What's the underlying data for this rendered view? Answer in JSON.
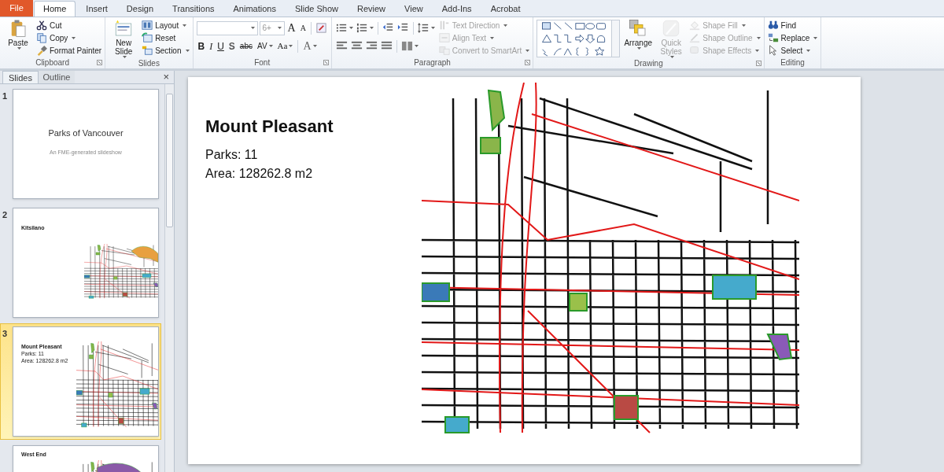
{
  "menu_tabs": [
    {
      "label": "File",
      "kind": "file",
      "selected": false
    },
    {
      "label": "Home",
      "kind": "tab",
      "selected": true
    },
    {
      "label": "Insert",
      "kind": "tab",
      "selected": false
    },
    {
      "label": "Design",
      "kind": "tab",
      "selected": false
    },
    {
      "label": "Transitions",
      "kind": "tab",
      "selected": false
    },
    {
      "label": "Animations",
      "kind": "tab",
      "selected": false
    },
    {
      "label": "Slide Show",
      "kind": "tab",
      "selected": false
    },
    {
      "label": "Review",
      "kind": "tab",
      "selected": false
    },
    {
      "label": "View",
      "kind": "tab",
      "selected": false
    },
    {
      "label": "Add-Ins",
      "kind": "tab",
      "selected": false
    },
    {
      "label": "Acrobat",
      "kind": "tab",
      "selected": false
    }
  ],
  "ribbon_groups": [
    {
      "label": "Clipboard",
      "columns": [
        [
          {
            "kind": "large",
            "label": "Paste",
            "dropdown": true,
            "disabled": false
          }
        ],
        [
          {
            "kind": "small",
            "label": "Cut",
            "dropdown": false,
            "disabled": false
          },
          {
            "kind": "small",
            "label": "Copy",
            "dropdown": true,
            "disabled": false
          },
          {
            "kind": "small",
            "label": "Format Painter",
            "dropdown": false,
            "disabled": false
          }
        ]
      ]
    },
    {
      "label": "Slides",
      "columns": [
        [
          {
            "kind": "large",
            "label": "New Slide",
            "dropdown": true,
            "disabled": false
          }
        ],
        [
          {
            "kind": "small",
            "label": "Layout",
            "dropdown": true,
            "disabled": false
          },
          {
            "kind": "small",
            "label": "Reset",
            "dropdown": false,
            "disabled": false
          },
          {
            "kind": "small",
            "label": "Section",
            "dropdown": true,
            "disabled": false
          }
        ]
      ]
    },
    {
      "label": "Font",
      "columns": [
        [
          {
            "kind": "row",
            "items": [
              {
                "kind": "combo"
              },
              {
                "kind": "combo",
                "value": "6+"
              },
              {
                "kind": "glyph",
                "label": "A"
              },
              {
                "kind": "glyph",
                "label": "A"
              },
              {
                "kind": "sep"
              },
              {
                "kind": "icon",
                "dropdown": false
              }
            ]
          },
          {
            "kind": "row",
            "items": [
              {
                "kind": "glyph",
                "label": "B"
              },
              {
                "kind": "glyph",
                "label": "I"
              },
              {
                "kind": "glyph",
                "label": "U"
              },
              {
                "kind": "glyph",
                "label": "S"
              },
              {
                "kind": "glyph",
                "label": "abc"
              },
              {
                "kind": "glyph",
                "label": "AV",
                "dropdown": true
              },
              {
                "kind": "glyph",
                "label": "Aa",
                "dropdown": true
              },
              {
                "kind": "sep"
              },
              {
                "kind": "glyph",
                "label": "A",
                "dropdown": true
              }
            ]
          }
        ]
      ]
    },
    {
      "label": "Paragraph",
      "columns": [
        [
          {
            "kind": "row",
            "items": [
              {
                "kind": "icon",
                "dropdown": true
              },
              {
                "kind": "icon",
                "dropdown": true
              },
              {
                "kind": "sep"
              },
              {
                "kind": "icon",
                "dropdown": false
              },
              {
                "kind": "icon",
                "dropdown": false
              },
              {
                "kind": "sep"
              },
              {
                "kind": "icon",
                "dropdown": true
              }
            ]
          },
          {
            "kind": "row",
            "items": [
              {
                "kind": "icon",
                "dropdown": false
              },
              {
                "kind": "icon",
                "dropdown": false
              },
              {
                "kind": "icon",
                "dropdown": false
              },
              {
                "kind": "icon",
                "dropdown": false
              },
              {
                "kind": "sep"
              },
              {
                "kind": "icon",
                "dropdown": true
              }
            ]
          }
        ],
        [
          {
            "kind": "small",
            "label": "Text Direction",
            "dropdown": true,
            "disabled": true
          },
          {
            "kind": "small",
            "label": "Align Text",
            "dropdown": true,
            "disabled": true
          },
          {
            "kind": "small",
            "label": "Convert to SmartArt",
            "dropdown": true,
            "disabled": true
          }
        ]
      ]
    },
    {
      "label": "Drawing",
      "columns": [
        [
          {
            "kind": "gallery"
          }
        ],
        [
          {
            "kind": "large",
            "label": "Arrange",
            "dropdown": true,
            "disabled": false
          }
        ],
        [
          {
            "kind": "large",
            "label": "Quick Styles",
            "dropdown": true,
            "disabled": true
          }
        ],
        [
          {
            "kind": "small",
            "label": "Shape Fill",
            "dropdown": true,
            "disabled": true
          },
          {
            "kind": "small",
            "label": "Shape Outline",
            "dropdown": true,
            "disabled": true
          },
          {
            "kind": "small",
            "label": "Shape Effects",
            "dropdown": true,
            "disabled": true
          }
        ]
      ]
    },
    {
      "label": "Editing",
      "columns": [
        [
          {
            "kind": "small",
            "label": "Find",
            "dropdown": false,
            "disabled": false
          },
          {
            "kind": "small",
            "label": "Replace",
            "dropdown": true,
            "disabled": false
          },
          {
            "kind": "small",
            "label": "Select",
            "dropdown": true,
            "disabled": false
          }
        ]
      ]
    }
  ],
  "pane": {
    "tabs": [
      {
        "label": "Slides",
        "selected": true
      },
      {
        "label": "Outline",
        "selected": false
      }
    ],
    "close": "×",
    "thumbnails": [
      {
        "number": "1",
        "kind": "title",
        "title": "Parks of Vancouver",
        "subtitle": "An FME-generated slideshow",
        "selected": false
      },
      {
        "number": "2",
        "kind": "map",
        "title": "Kitsilano",
        "selected": false
      },
      {
        "number": "3",
        "kind": "map",
        "title": "Mount Pleasant",
        "lines": [
          "Parks: 11",
          "Area: 128262.8 m2"
        ],
        "selected": true
      },
      {
        "kind": "map",
        "title": "West End",
        "selected": false
      }
    ]
  },
  "slide": {
    "title": "Mount Pleasant",
    "lines": [
      "Parks: 11",
      "Area: 128262.8 m2"
    ],
    "map": {
      "kind": "picture"
    }
  }
}
